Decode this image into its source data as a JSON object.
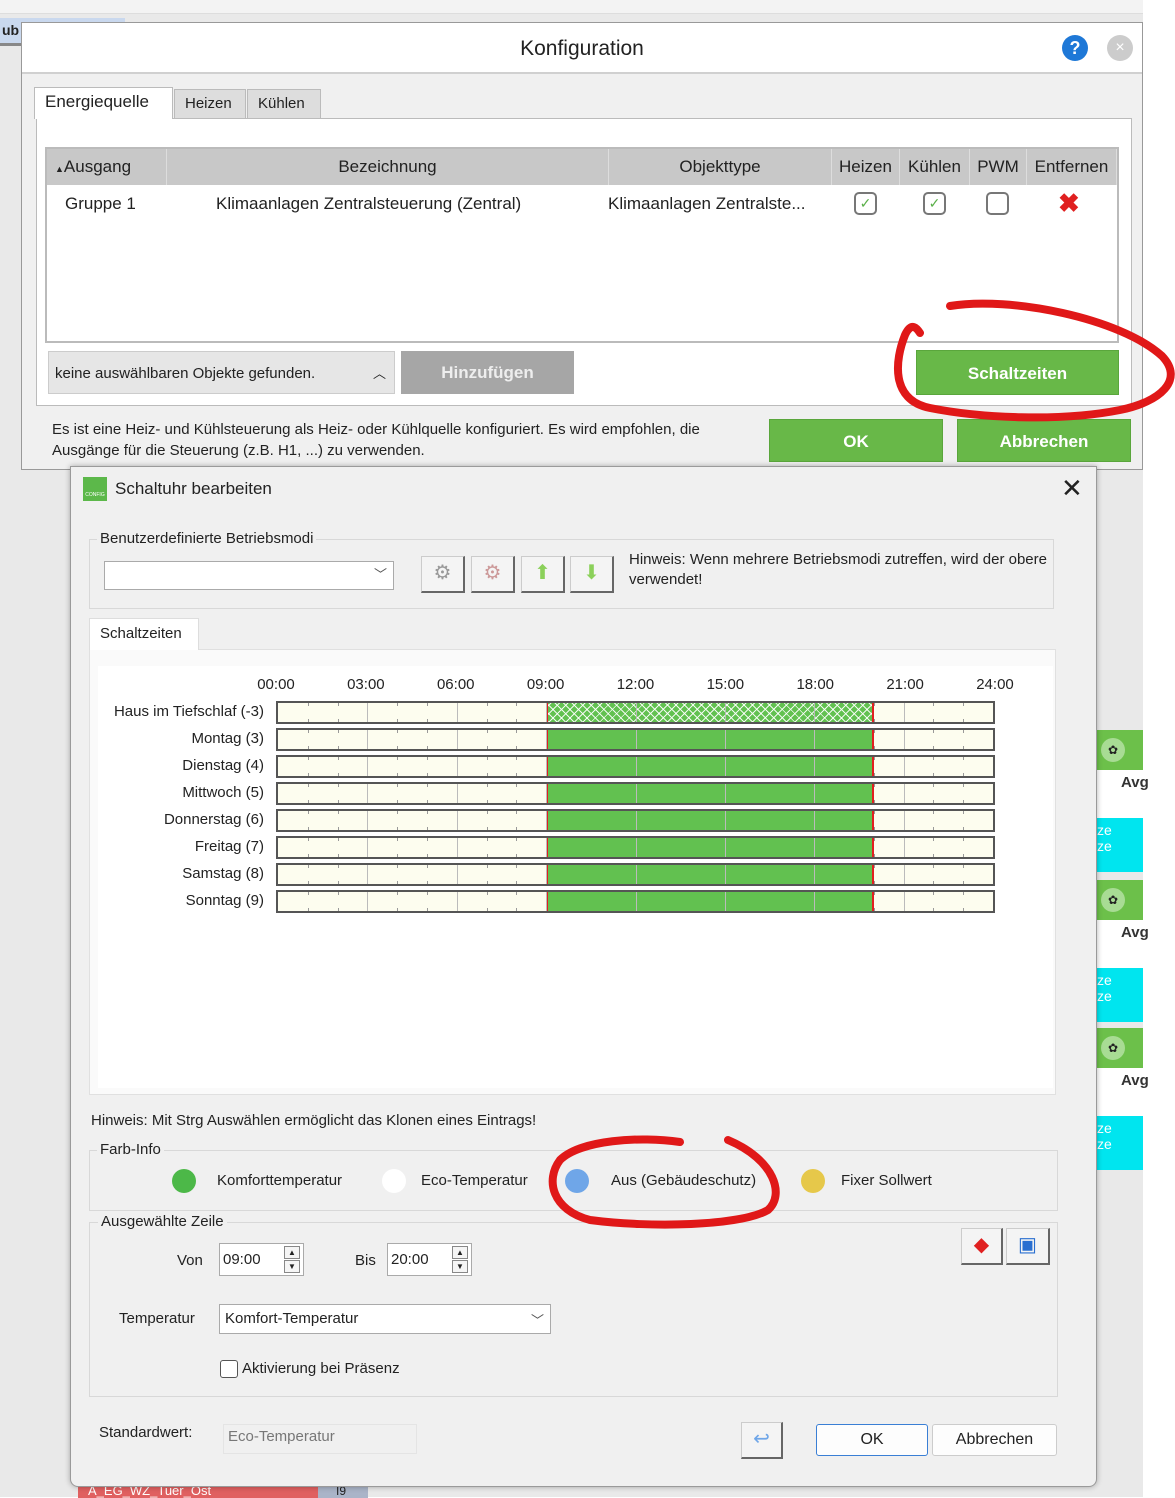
{
  "background": {
    "tab_fragment": "ub",
    "right_cards": [
      {
        "label": "Avg",
        "sub1": "ze",
        "sub2": "ze"
      },
      {
        "label": "Avg",
        "sub1": "ze",
        "sub2": "ze"
      },
      {
        "label": "Avg",
        "sub1": "ze",
        "sub2": "ze"
      }
    ],
    "bottom_tab": "A_EG_WZ_Tuer_Ost",
    "bottom_badge": "I9"
  },
  "konfig": {
    "title": "Konfiguration",
    "help_icon": "?",
    "close_icon": "×",
    "tabs": [
      {
        "label": "Energiequelle",
        "active": true
      },
      {
        "label": "Heizen"
      },
      {
        "label": "Kühlen"
      }
    ],
    "table": {
      "columns": [
        "Ausgang",
        "Bezeichnung",
        "Objekttype",
        "Heizen",
        "Kühlen",
        "PWM",
        "Entfernen"
      ],
      "rows": [
        {
          "ausgang": "Gruppe 1",
          "bezeichnung": "Klimaanlagen Zentralsteuerung (Zentral)",
          "objekttype": "Klimaanlagen Zentralste...",
          "heizen": true,
          "kuehlen": true,
          "pwm": false,
          "remove_icon": "✖"
        }
      ]
    },
    "combo_text": "keine auswählbaren Objekte gefunden.",
    "add_button": "Hinzufügen",
    "schaltzeiten_button": "Schaltzeiten",
    "message": "Es ist eine Heiz- und Kühlsteuerung als Heiz- oder Kühlquelle konfiguriert. Es wird empfohlen, die Ausgänge für die Steuerung (z.B. H1, ...) zu verwenden.",
    "ok_button": "OK",
    "cancel_button": "Abbrechen"
  },
  "schaltuhr": {
    "title": "Schaltuhr bearbeiten",
    "icon_text": "CONFIG",
    "modes_group": "Benutzerdefinierte Betriebsmodi",
    "modes_select": "",
    "modes_hint": "Hinweis: Wenn mehrere Betriebsmodi zutreffen, wird der obere verwendet!",
    "tab": "Schaltzeiten",
    "times": [
      "00:00",
      "03:00",
      "06:00",
      "09:00",
      "12:00",
      "15:00",
      "18:00",
      "21:00",
      "24:00"
    ],
    "rows": [
      {
        "label": "Haus im Tiefschlaf (-3)",
        "segments": [
          {
            "start": 9,
            "end": 20,
            "mode": "komfort",
            "hatched": true
          }
        ]
      },
      {
        "label": "Montag (3)",
        "segments": [
          {
            "start": 9,
            "end": 20,
            "mode": "komfort"
          }
        ]
      },
      {
        "label": "Dienstag (4)",
        "segments": [
          {
            "start": 9,
            "end": 20,
            "mode": "komfort"
          }
        ]
      },
      {
        "label": "Mittwoch (5)",
        "segments": [
          {
            "start": 9,
            "end": 20,
            "mode": "komfort"
          }
        ]
      },
      {
        "label": "Donnerstag (6)",
        "segments": [
          {
            "start": 9,
            "end": 20,
            "mode": "komfort"
          }
        ]
      },
      {
        "label": "Freitag (7)",
        "segments": [
          {
            "start": 9,
            "end": 20,
            "mode": "komfort"
          }
        ]
      },
      {
        "label": "Samstag (8)",
        "segments": [
          {
            "start": 9,
            "end": 20,
            "mode": "komfort"
          }
        ]
      },
      {
        "label": "Sonntag (9)",
        "segments": [
          {
            "start": 9,
            "end": 20,
            "mode": "komfort"
          }
        ]
      }
    ],
    "clone_hint": "Hinweis: Mit Strg Auswählen ermöglicht das Klonen eines Eintrags!",
    "farb_info": {
      "label": "Farb-Info",
      "items": [
        {
          "label": "Komforttemperatur",
          "color": "#4cb848"
        },
        {
          "label": "Eco-Temperatur",
          "color": "#ffffff"
        },
        {
          "label": "Aus (Gebäudeschutz)",
          "color": "#6fa6e8"
        },
        {
          "label": "Fixer Sollwert",
          "color": "#e6c84a"
        }
      ]
    },
    "selected_row": {
      "label": "Ausgewählte Zeile",
      "von_label": "Von",
      "von": "09:00",
      "bis_label": "Bis",
      "bis": "20:00",
      "temp_label": "Temperatur",
      "temp": "Komfort-Temperatur",
      "presence_label": "Aktivierung bei Präsenz",
      "presence": false
    },
    "default_label": "Standardwert:",
    "default_value": "Eco-Temperatur",
    "ok_button": "OK",
    "cancel_button": "Abbrechen"
  },
  "colors": {
    "green": "#62c150",
    "button_green": "#68b848",
    "annotation_red": "#e01818"
  }
}
